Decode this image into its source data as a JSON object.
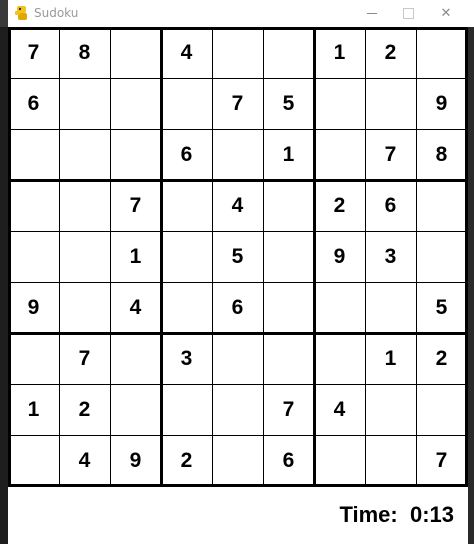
{
  "window": {
    "title": "Sudoku",
    "minimize_glyph": "—",
    "close_glyph": "✕"
  },
  "icons": {
    "app": "python-snake-icon",
    "minimize": "minimize-icon",
    "maximize": "maximize-icon",
    "close": "close-icon"
  },
  "board": {
    "rows": [
      [
        "7",
        "8",
        "",
        "4",
        "",
        "",
        "1",
        "2",
        ""
      ],
      [
        "6",
        "",
        "",
        "",
        "7",
        "5",
        "",
        "",
        "9"
      ],
      [
        "",
        "",
        "",
        "6",
        "",
        "1",
        "",
        "7",
        "8"
      ],
      [
        "",
        "",
        "7",
        "",
        "4",
        "",
        "2",
        "6",
        ""
      ],
      [
        "",
        "",
        "1",
        "",
        "5",
        "",
        "9",
        "3",
        ""
      ],
      [
        "9",
        "",
        "4",
        "",
        "6",
        "",
        "",
        "",
        "5"
      ],
      [
        "",
        "7",
        "",
        "3",
        "",
        "",
        "",
        "1",
        "2"
      ],
      [
        "1",
        "2",
        "",
        "",
        "",
        "7",
        "4",
        "",
        ""
      ],
      [
        "",
        "4",
        "9",
        "2",
        "",
        "6",
        "",
        "",
        "7"
      ]
    ]
  },
  "status": {
    "timer_label": "Time:",
    "timer_value": "0:13"
  },
  "colors": {
    "grid_line": "#000000",
    "background": "#ffffff",
    "digit": "#000000"
  }
}
